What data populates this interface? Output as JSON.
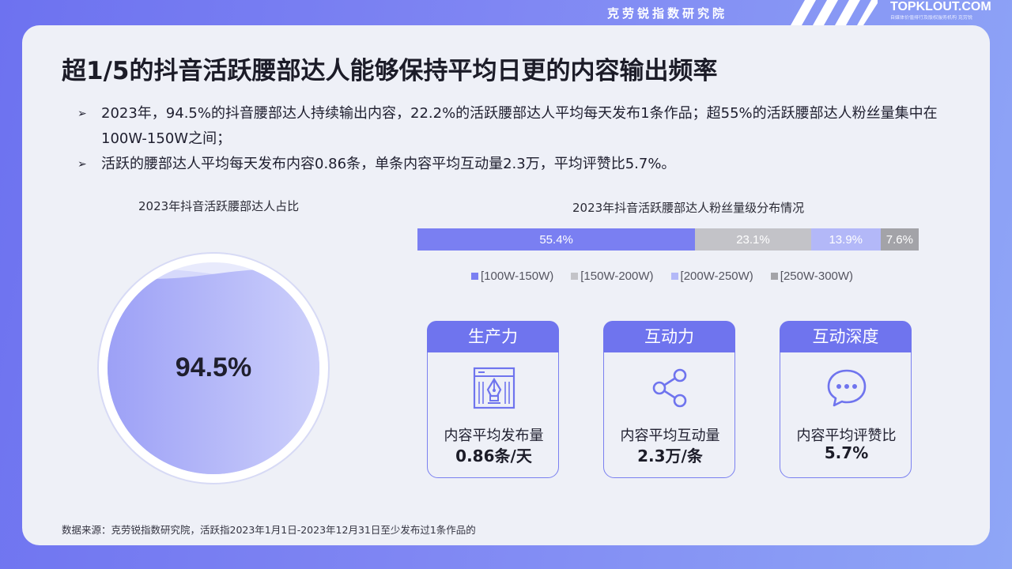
{
  "header": {
    "brand": "克劳锐指数研究院",
    "logo": "TOPKLOUT.COM",
    "logo_sub": "自媒体价值排行及版权服务机构 克劳锐"
  },
  "page": {
    "title": "超1/5的抖音活跃腰部达人能够保持平均日更的内容输出频率",
    "bullets": [
      "2023年，94.5%的抖音腰部达人持续输出内容，22.2%的活跃腰部达人平均每天发布1条作品；超55%的活跃腰部达人粉丝量集中在100W-150W之间；",
      "活跃的腰部达人平均每天发布内容0.86条，单条内容平均互动量2.3万，平均评赞比5.7%。"
    ],
    "bullet_mark": "➢",
    "source": "数据来源：克劳锐指数研究院，活跃指2023年1月1日-2023年12月31日至少发布过1条作品的"
  },
  "colors": {
    "primary": "#6f74ee",
    "bar1": "#7a7ff2",
    "bar2": "#c3c3c8",
    "bar3": "#b3b8f8",
    "bar4": "#a3a3a8"
  },
  "chart_data": [
    {
      "type": "pie",
      "title": "2023年抖音活跃腰部达人占比",
      "value": 94.5,
      "label": "94.5%"
    },
    {
      "type": "bar",
      "stacked": true,
      "title": "2023年抖音活跃腰部达人粉丝量级分布情况",
      "categories": [
        "[100W-150W)",
        "[150W-200W)",
        "[200W-250W)",
        "[250W-300W)"
      ],
      "values": [
        55.4,
        23.1,
        13.9,
        7.6
      ],
      "labels": [
        "55.4%",
        "23.1%",
        "13.9%",
        "7.6%"
      ],
      "legend_position": "bottom"
    }
  ],
  "metrics": [
    {
      "header": "生产力",
      "icon": "pen-nib-icon",
      "label": "内容平均发布量",
      "value": "0.86条/天"
    },
    {
      "header": "互动力",
      "icon": "share-icon",
      "label": "内容平均互动量",
      "value": "2.3万/条"
    },
    {
      "header": "互动深度",
      "icon": "chat-bubble-icon",
      "label": "内容平均评赞比",
      "value": "5.7%"
    }
  ]
}
